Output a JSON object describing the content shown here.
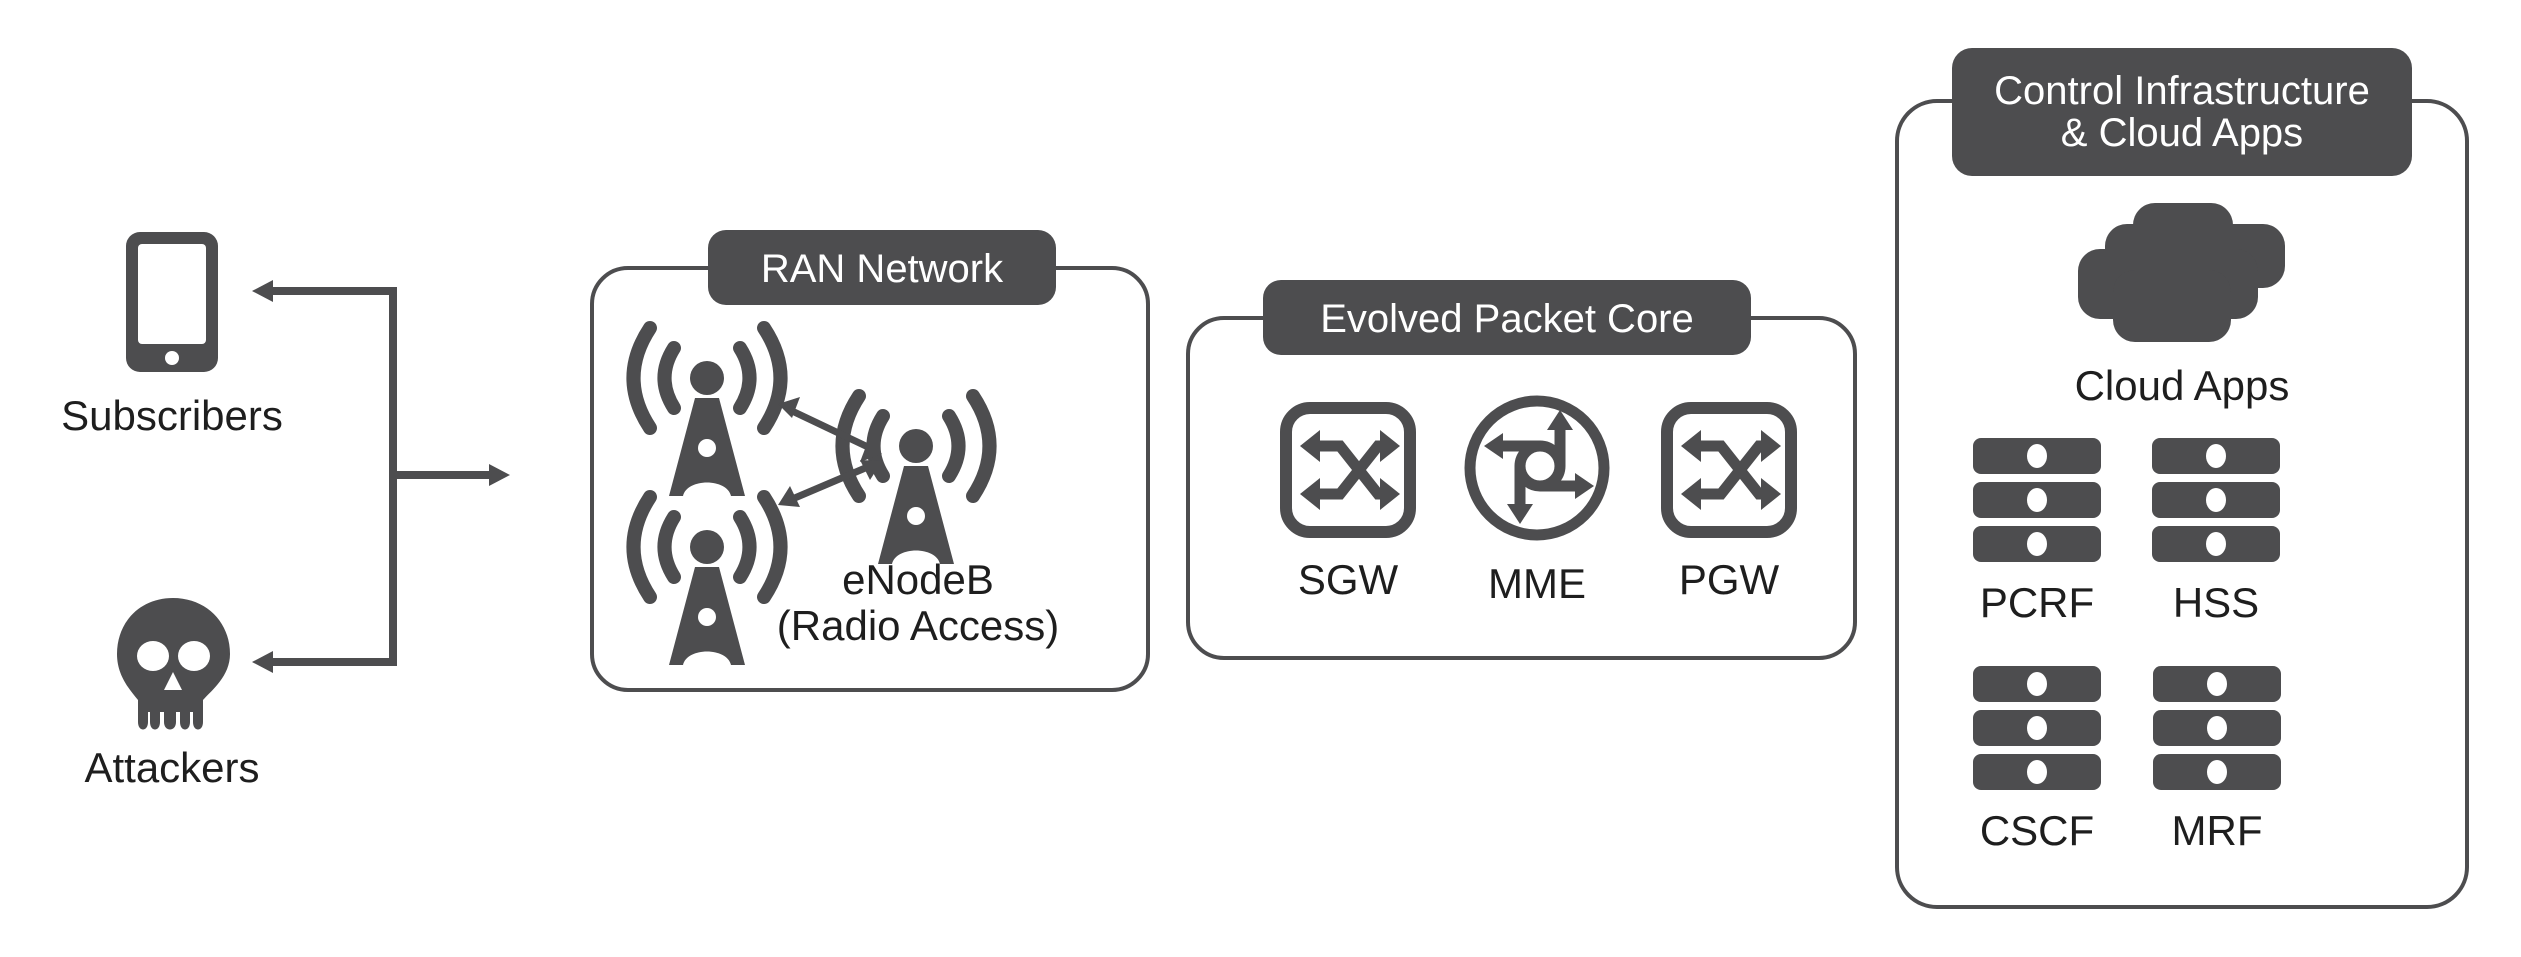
{
  "diagram": {
    "colors": {
      "ink": "#4d4d4f",
      "text": "#1e1e1e",
      "background": "#ffffff"
    },
    "actors": {
      "subscribers": {
        "label": "Subscribers",
        "icon": "smartphone-icon"
      },
      "attackers": {
        "label": "Attackers",
        "icon": "skull-icon"
      }
    },
    "ran": {
      "title": "RAN Network",
      "enodeb_label_line1": "eNodeB",
      "enodeb_label_line2": "(Radio Access)",
      "icons": [
        "cell-tower-icon",
        "cell-tower-icon",
        "cell-tower-icon"
      ]
    },
    "epc": {
      "title": "Evolved Packet Core",
      "nodes": [
        {
          "label": "SGW",
          "icon": "switch-icon"
        },
        {
          "label": "MME",
          "icon": "router-icon"
        },
        {
          "label": "PGW",
          "icon": "switch-icon"
        }
      ]
    },
    "control": {
      "title_line1": "Control Infrastructure",
      "title_line2": "& Cloud Apps",
      "cloud_label": "Cloud Apps",
      "servers": [
        {
          "label": "PCRF",
          "icon": "server-stack-icon"
        },
        {
          "label": "HSS",
          "icon": "server-stack-icon"
        },
        {
          "label": "CSCF",
          "icon": "server-stack-icon"
        },
        {
          "label": "MRF",
          "icon": "server-stack-icon"
        }
      ]
    }
  }
}
